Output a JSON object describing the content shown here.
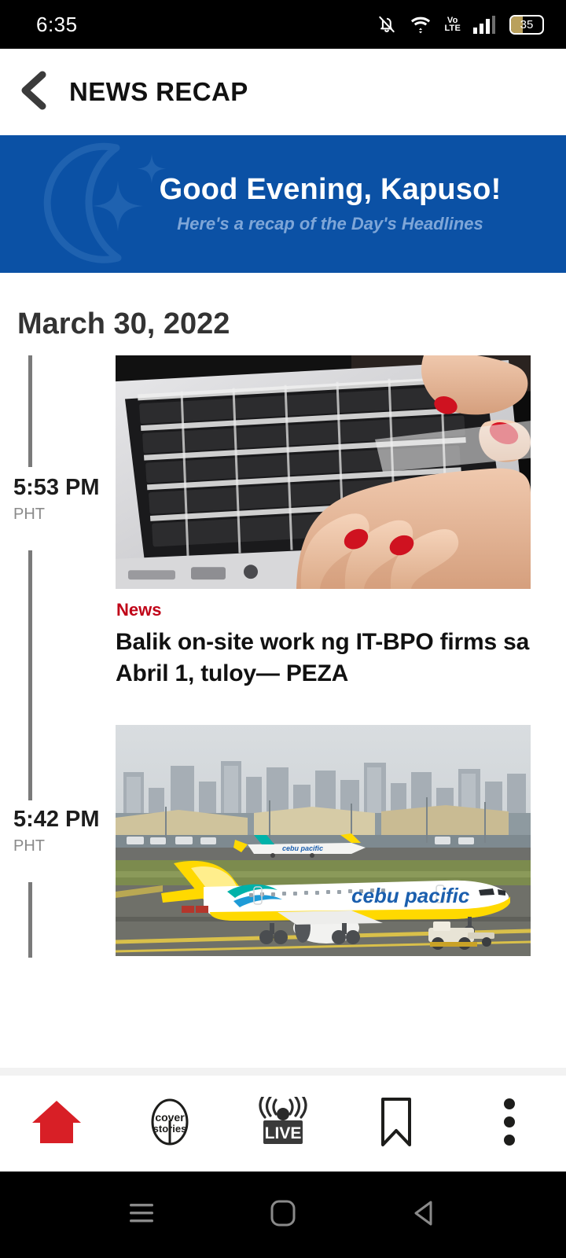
{
  "status_bar": {
    "time": "6:35",
    "battery_percent": "35",
    "icons": [
      "bell-off-icon",
      "wifi-icon",
      "volte-icon",
      "signal-icon",
      "battery-icon"
    ],
    "volte_top": "Vo",
    "volte_bottom": "LTE"
  },
  "header": {
    "title": "NEWS RECAP",
    "back_icon": "back-chevron-icon"
  },
  "greeting": {
    "title": "Good Evening, Kapuso!",
    "subtitle": "Here's a recap of the Day's Headlines",
    "art_icon": "crescent-moon-stars-icon",
    "background_color": "#0b51a5",
    "subtitle_color": "#7ea6d8"
  },
  "date_heading": "March 30, 2022",
  "articles": [
    {
      "time": "5:53",
      "ampm": "PM",
      "timezone": "PHT",
      "category": "News",
      "category_color": "#c00418",
      "headline": "Balik on-site work ng IT-BPO firms sa Abril 1, tuloy— PEZA",
      "image_alt": "hands-typing-on-laptop-keyboard"
    },
    {
      "time": "5:42",
      "ampm": "PM",
      "timezone": "PHT",
      "category": "",
      "headline": "",
      "image_alt": "cebu-pacific-airplane-on-tarmac"
    }
  ],
  "bottom_nav": {
    "items": [
      {
        "name": "home",
        "icon": "home-icon",
        "active": true
      },
      {
        "name": "cover-stories",
        "icon": "cover-stories-icon",
        "label_top": "cover",
        "label_bottom": "stories",
        "active": false
      },
      {
        "name": "live",
        "icon": "live-broadcast-icon",
        "label": "LIVE",
        "active": false
      },
      {
        "name": "bookmarks",
        "icon": "bookmark-icon",
        "active": false
      },
      {
        "name": "more",
        "icon": "more-vertical-icon",
        "active": false
      }
    ],
    "active_color": "#d81f26"
  },
  "system_nav": {
    "buttons": [
      "recents-icon",
      "home-square-icon",
      "back-triangle-icon"
    ]
  }
}
